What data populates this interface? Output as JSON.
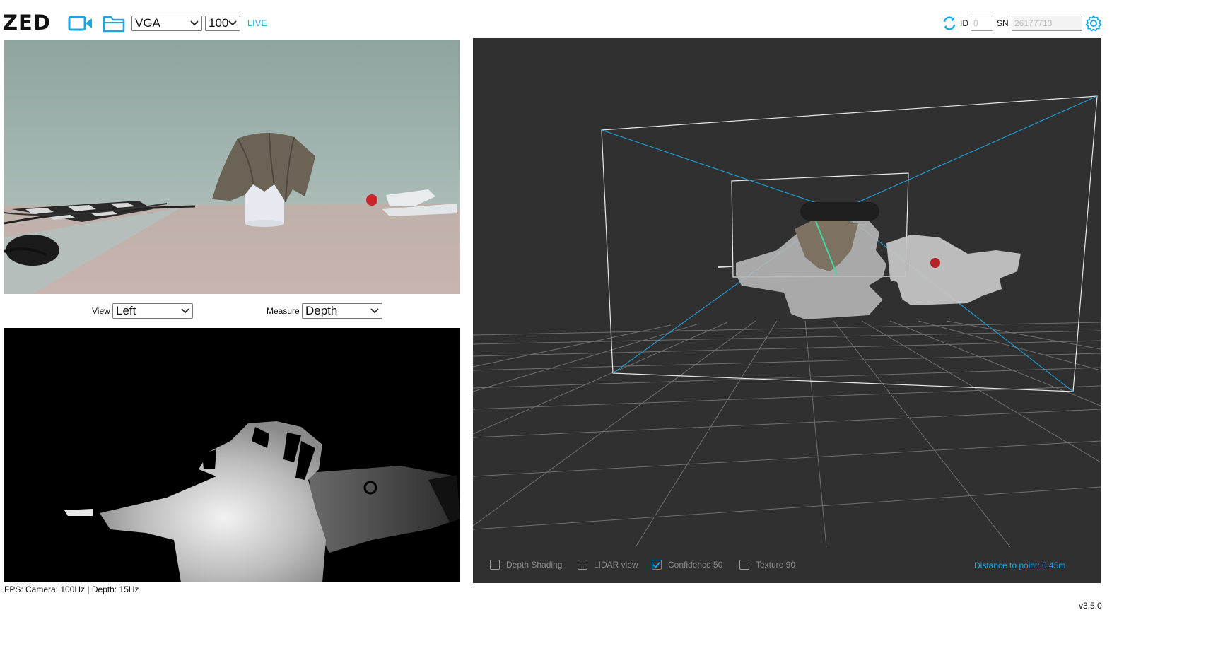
{
  "header": {
    "logo": "ZED",
    "resolution": "VGA",
    "fps": "100",
    "live": "LIVE",
    "id_label": "ID",
    "id_value": "0",
    "sn_label": "SN",
    "sn_value": "26177713"
  },
  "left_controls": {
    "view_label": "View",
    "view_value": "Left",
    "measure_label": "Measure",
    "measure_value": "Depth"
  },
  "viewer3d": {
    "checkboxes": [
      {
        "label": "Depth Shading",
        "checked": false
      },
      {
        "label": "LIDAR view",
        "checked": false
      },
      {
        "label": "Confidence 50",
        "checked": true
      },
      {
        "label": "Texture 90",
        "checked": false
      }
    ],
    "distance": "Distance to point: 0.45m"
  },
  "footer": {
    "fps_text": "FPS: Camera: 100Hz | Depth: 15Hz",
    "version": "v3.5.0"
  },
  "colors": {
    "accent": "#1aa7e6",
    "viewport_bg": "#303030",
    "cube_edge": "#1aa7e6",
    "depth_line": "#3fd6a0"
  },
  "icons": [
    "video-camera-icon",
    "folder-icon",
    "refresh-icon",
    "gear-icon",
    "chevron-down-icon",
    "checkmark-icon"
  ]
}
